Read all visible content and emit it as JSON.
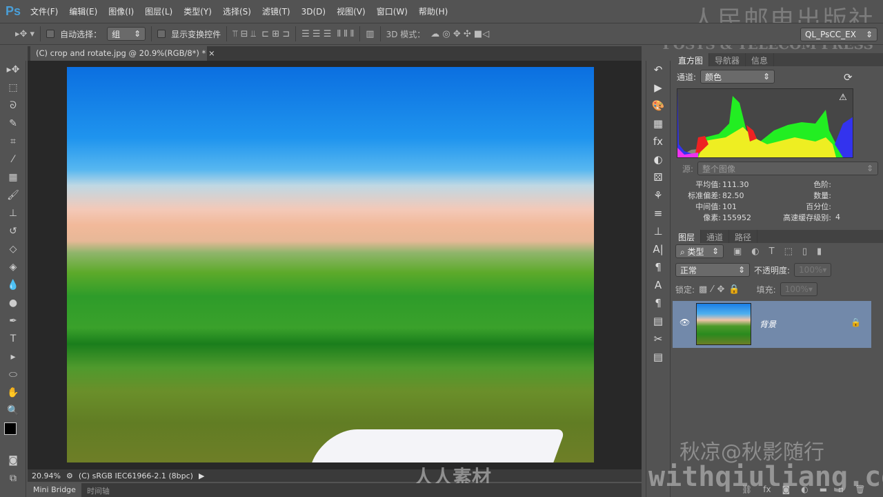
{
  "app": {
    "logo": "Ps"
  },
  "menu": [
    "文件(F)",
    "编辑(E)",
    "图像(I)",
    "图层(L)",
    "类型(Y)",
    "选择(S)",
    "滤镜(T)",
    "3D(D)",
    "视图(V)",
    "窗口(W)",
    "帮助(H)"
  ],
  "options": {
    "auto_select_label": "自动选择：",
    "auto_select_value": "组",
    "show_transform_label": "显示变换控件",
    "mode3d_label": "3D 模式：",
    "workspace": "QL_PsCC_EX"
  },
  "document": {
    "tab_title": "(C) crop and rotate.jpg @ 20.9%(RGB/8*) *",
    "close": "×"
  },
  "status": {
    "zoom": "20.94%",
    "profile": "(C) sRGB IEC61966-2.1 (8bpc)"
  },
  "bottom_tabs": [
    "Mini Bridge",
    "时间轴"
  ],
  "histogram": {
    "tabs": [
      "直方图",
      "导航器",
      "信息"
    ],
    "channel_label": "通道:",
    "channel_value": "颜色",
    "source_label": "源:",
    "source_value": "整个图像",
    "stats": {
      "mean_label": "平均值:",
      "mean": "111.30",
      "std_label": "标准偏差:",
      "std": "82.50",
      "median_label": "中间值:",
      "median": "101",
      "pixels_label": "像素:",
      "pixels": "155952",
      "level_label": "色阶:",
      "count_label": "数量:",
      "percentile_label": "百分位:",
      "cache_label": "高速缓存级别:",
      "cache": "4"
    }
  },
  "layers": {
    "tabs": [
      "图层",
      "通道",
      "路径"
    ],
    "filter": "类型",
    "blend_mode": "正常",
    "opacity_label": "不透明度:",
    "opacity": "100%",
    "lock_label": "锁定:",
    "fill_label": "填充:",
    "fill": "100%",
    "items": [
      {
        "name": "背景",
        "visible": true,
        "locked": true
      }
    ]
  },
  "watermarks": {
    "publisher_cn": "人民邮电出版社",
    "publisher_en": "POSTS & TELECOM PRESS",
    "author": "秋凉@秋影随行",
    "site": "withqiuliang.com",
    "brand": "人人素材"
  }
}
